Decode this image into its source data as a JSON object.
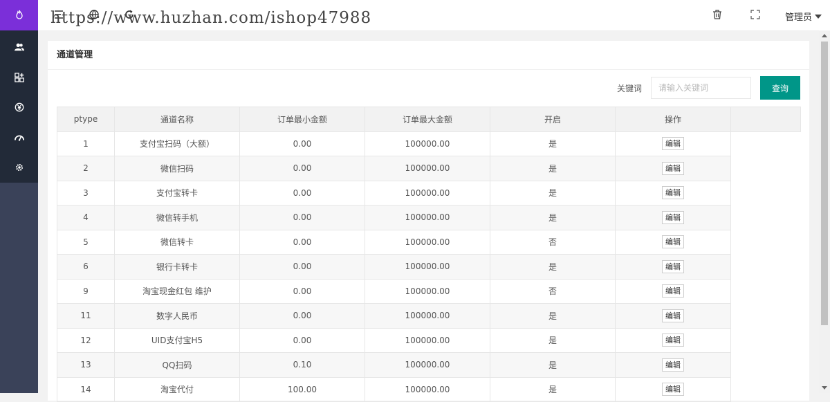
{
  "header": {
    "watermark": "https://www.huzhan.com/ishop47988",
    "admin_label": "管理员"
  },
  "page": {
    "title": "通道管理"
  },
  "search": {
    "label": "关键词",
    "placeholder": "请输入关键词",
    "button": "查询"
  },
  "table": {
    "headers": [
      "ptype",
      "通道名称",
      "订单最小金额",
      "订单最大金额",
      "开启",
      "操作"
    ],
    "edit_label": "编辑",
    "rows": [
      {
        "ptype": "1",
        "name": "支付宝扫码（大额）",
        "min": "0.00",
        "max": "100000.00",
        "enabled": "是"
      },
      {
        "ptype": "2",
        "name": "微信扫码",
        "min": "0.00",
        "max": "100000.00",
        "enabled": "是"
      },
      {
        "ptype": "3",
        "name": "支付宝转卡",
        "min": "0.00",
        "max": "100000.00",
        "enabled": "是"
      },
      {
        "ptype": "4",
        "name": "微信转手机",
        "min": "0.00",
        "max": "100000.00",
        "enabled": "是"
      },
      {
        "ptype": "5",
        "name": "微信转卡",
        "min": "0.00",
        "max": "100000.00",
        "enabled": "否"
      },
      {
        "ptype": "6",
        "name": "银行卡转卡",
        "min": "0.00",
        "max": "100000.00",
        "enabled": "是"
      },
      {
        "ptype": "9",
        "name": "淘宝现金红包 维护",
        "min": "0.00",
        "max": "100000.00",
        "enabled": "否"
      },
      {
        "ptype": "11",
        "name": "数字人民币",
        "min": "0.00",
        "max": "100000.00",
        "enabled": "是"
      },
      {
        "ptype": "12",
        "name": "UID支付宝H5",
        "min": "0.00",
        "max": "100000.00",
        "enabled": "是"
      },
      {
        "ptype": "13",
        "name": "QQ扫码",
        "min": "0.10",
        "max": "100000.00",
        "enabled": "是"
      },
      {
        "ptype": "14",
        "name": "淘宝代付",
        "min": "100.00",
        "max": "100000.00",
        "enabled": "是"
      }
    ]
  },
  "colors": {
    "sidebar": "#3a4259",
    "sidebar_nav": "#222a38",
    "logo_bg": "#7b2fd9",
    "primary_button": "#009688"
  },
  "icons": {
    "sidebar": [
      "users-icon",
      "apps-add-icon",
      "yen-circle-icon",
      "dashboard-icon",
      "settings-icon"
    ],
    "header": [
      "menu-toggle-icon",
      "globe-icon",
      "refresh-icon",
      "trash-icon",
      "fullscreen-icon"
    ]
  }
}
